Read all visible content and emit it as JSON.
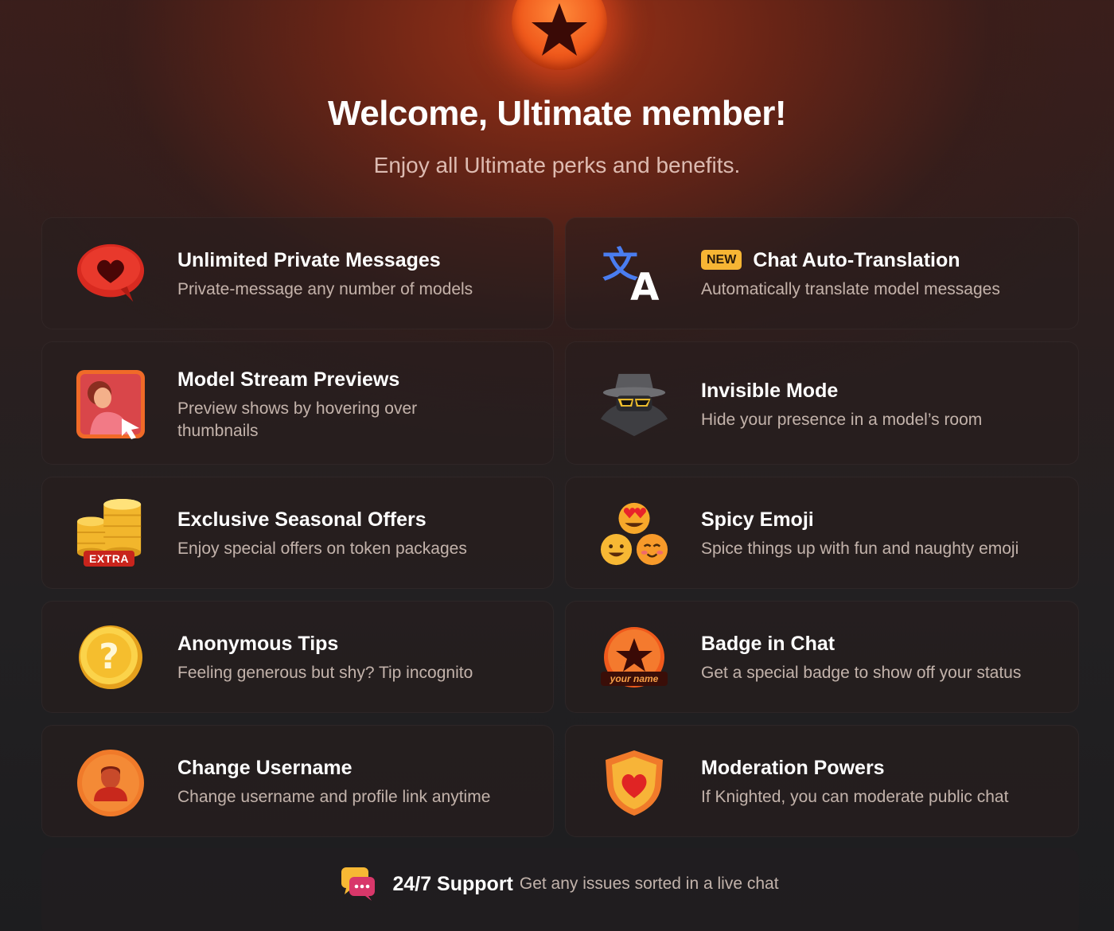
{
  "header": {
    "title": "Welcome, Ultimate member!",
    "subtitle": "Enjoy all Ultimate perks and benefits."
  },
  "perks": [
    {
      "title": "Unlimited Private Messages",
      "desc": "Private-message any number of models",
      "icon": "heart-chat-bubble-icon"
    },
    {
      "title": "Chat Auto-Translation",
      "desc": "Automatically translate model messages",
      "icon": "translate-icon",
      "badge": "NEW"
    },
    {
      "title": "Model Stream Previews",
      "desc": "Preview shows by hovering over thumbnails",
      "icon": "stream-preview-icon"
    },
    {
      "title": "Invisible Mode",
      "desc": "Hide your presence in a model’s room",
      "icon": "spy-icon"
    },
    {
      "title": "Exclusive Seasonal Offers",
      "desc": "Enjoy special offers on token packages",
      "icon": "coins-icon",
      "icon_label": "EXTRA"
    },
    {
      "title": "Spicy Emoji",
      "desc": "Spice things up with fun and naughty emoji",
      "icon": "emoji-icon"
    },
    {
      "title": "Anonymous Tips",
      "desc": "Feeling generous but shy? Tip incognito",
      "icon": "question-coin-icon"
    },
    {
      "title": "Badge in Chat",
      "desc": "Get a special badge to show off your status",
      "icon": "star-badge-icon",
      "icon_label": "your name"
    },
    {
      "title": "Change Username",
      "desc": "Change username and profile link anytime",
      "icon": "user-avatar-icon"
    },
    {
      "title": "Moderation Powers",
      "desc": "If Knighted, you can moderate public chat",
      "icon": "shield-heart-icon"
    }
  ],
  "support": {
    "title": "24/7 Support",
    "desc": "Get any issues sorted in a live chat",
    "icon": "chat-bubbles-icon"
  },
  "colors": {
    "accent": "#f05a1c",
    "new_badge": "#f7b534",
    "heart_red": "#e02424",
    "gold": "#f5c53a"
  }
}
